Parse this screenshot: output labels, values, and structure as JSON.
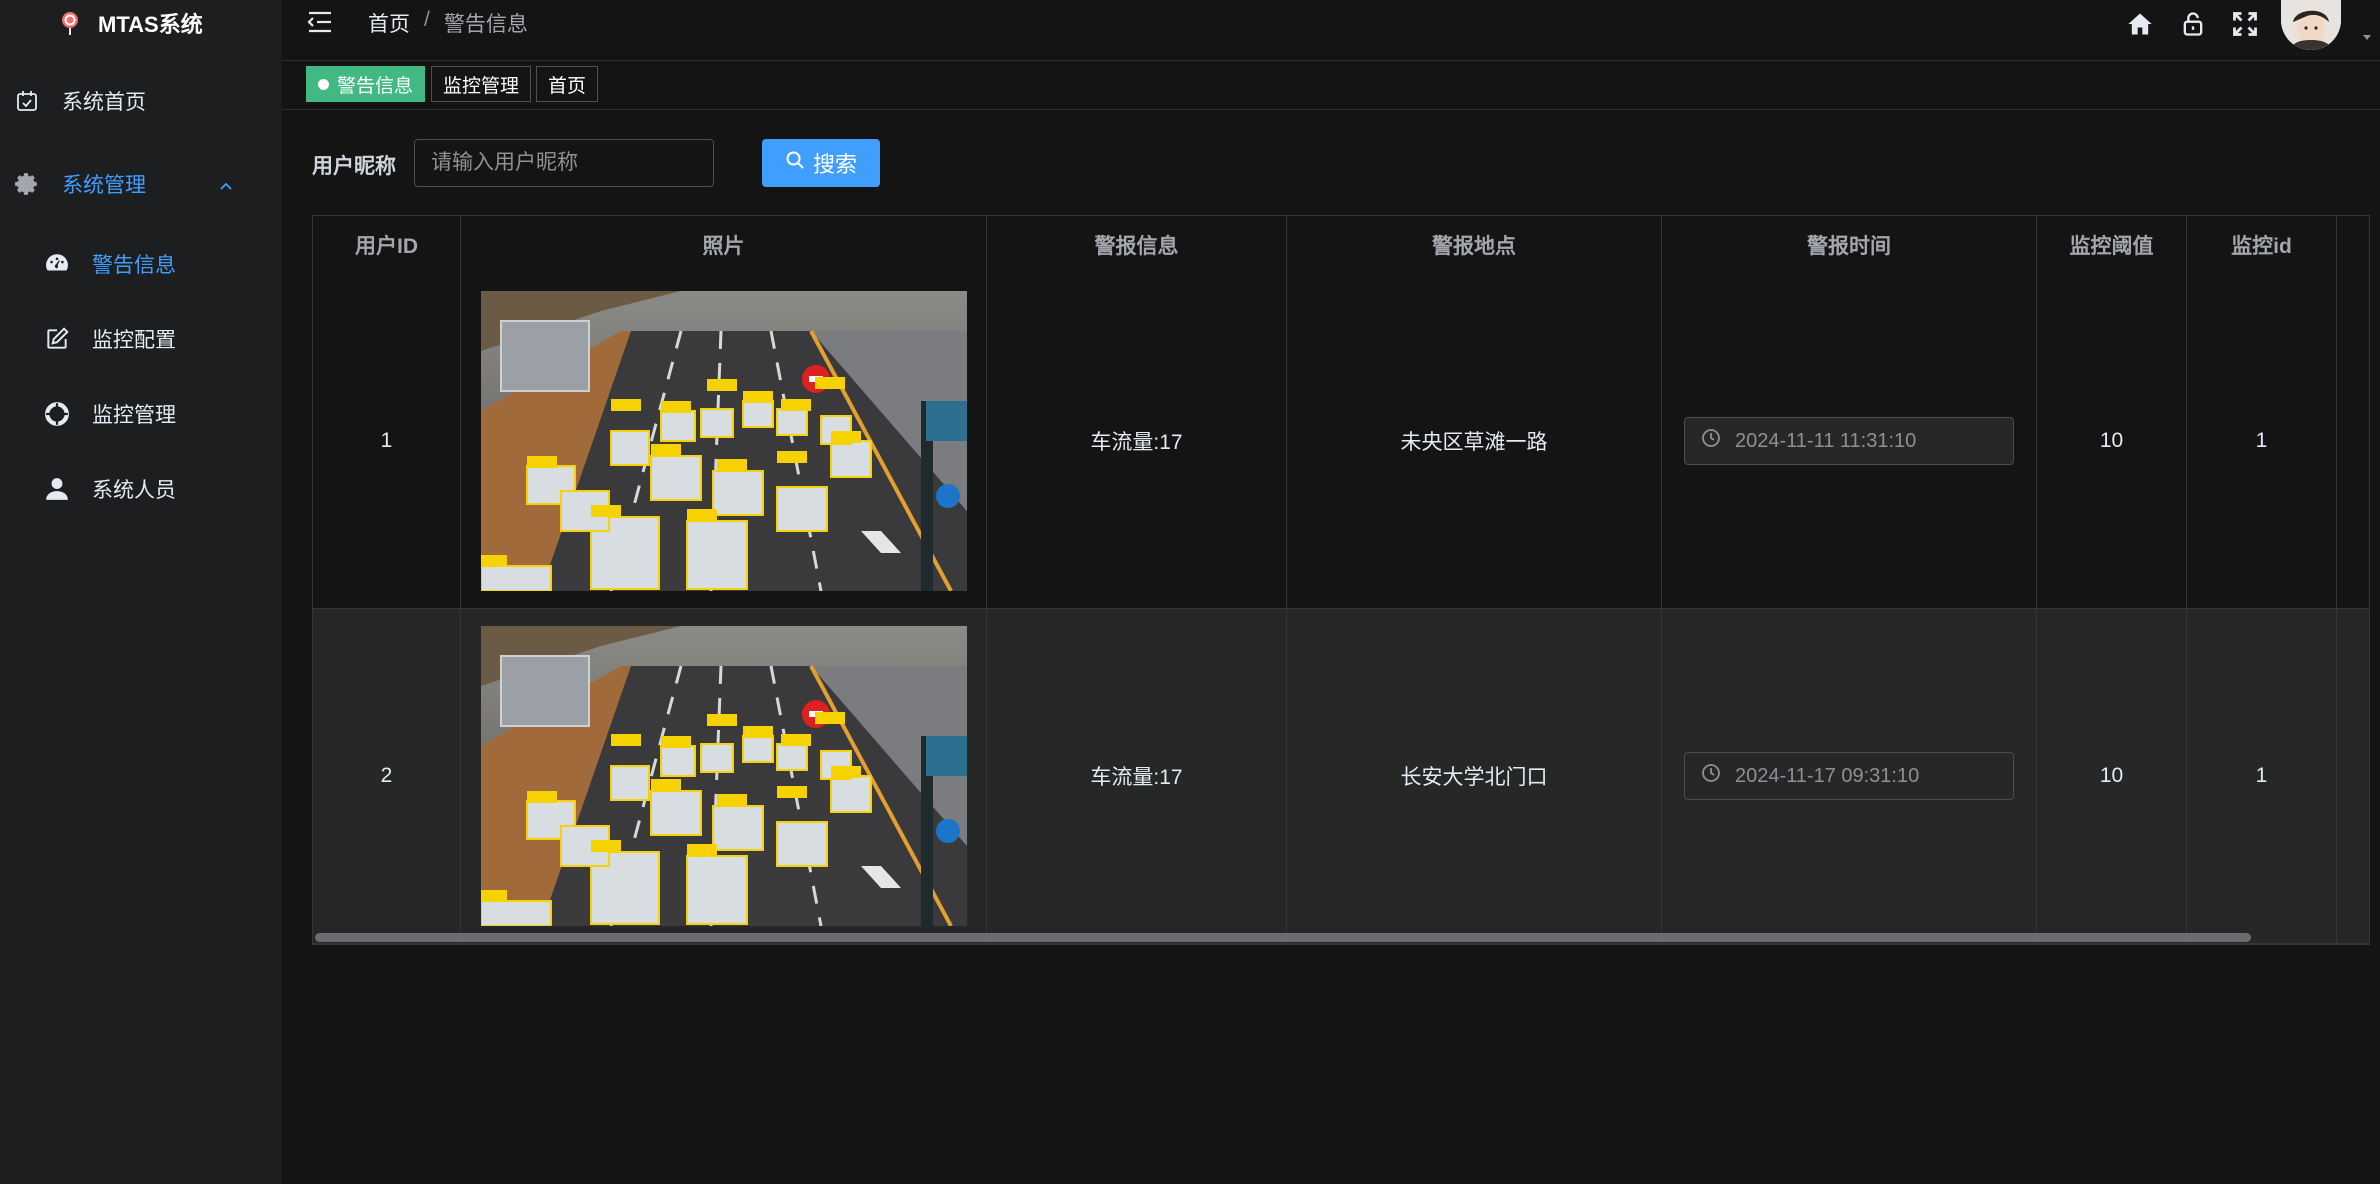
{
  "app": {
    "title": "MTAS系统"
  },
  "sidebar": {
    "items": [
      {
        "label": "系统首页",
        "icon": "calendar-check-icon",
        "active": false
      },
      {
        "label": "系统管理",
        "icon": "gear-icon",
        "active": true,
        "expanded": true
      },
      {
        "label": "警告信息",
        "icon": "dashboard-icon",
        "active": true
      },
      {
        "label": "监控配置",
        "icon": "edit-icon",
        "active": false
      },
      {
        "label": "监控管理",
        "icon": "lifebuoy-icon",
        "active": false
      },
      {
        "label": "系统人员",
        "icon": "user-icon",
        "active": false
      }
    ]
  },
  "header": {
    "breadcrumb": [
      "首页",
      "警告信息"
    ],
    "separator": "/"
  },
  "tags": [
    {
      "label": "警告信息",
      "active": true
    },
    {
      "label": "监控管理",
      "active": false
    },
    {
      "label": "首页",
      "active": false
    }
  ],
  "search": {
    "label": "用户昵称",
    "placeholder": "请输入用户昵称",
    "value": "",
    "button_label": "搜索"
  },
  "table": {
    "columns": [
      "用户ID",
      "照片",
      "警报信息",
      "警报地点",
      "警报时间",
      "监控阈值",
      "监控id"
    ],
    "rows": [
      {
        "user_id": "1",
        "alarm_info": "车流量:17",
        "location": "未央区草滩一路",
        "time": "2024-11-11 11:31:10",
        "threshold": "10",
        "monitor_id": "1"
      },
      {
        "user_id": "2",
        "alarm_info": "车流量:17",
        "location": "长安大学北门口",
        "time": "2024-11-17 09:31:10",
        "threshold": "10",
        "monitor_id": "1"
      }
    ]
  },
  "colors": {
    "accent": "#409eff",
    "tag_active": "#42b983",
    "background": "#141414",
    "sidebar": "#1d1e1f"
  }
}
